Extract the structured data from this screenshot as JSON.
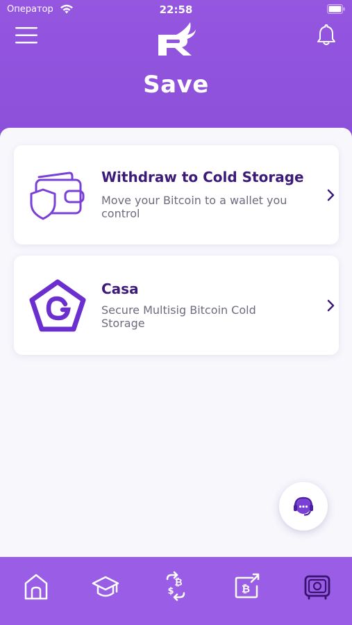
{
  "status_bar": {
    "carrier": "Оператор",
    "time": "22:58"
  },
  "header": {
    "title": "Save"
  },
  "cards": [
    {
      "title": "Withdraw to Cold Storage",
      "description": "Move your Bitcoin to a wallet you control",
      "icon": "wallet-shield-icon"
    },
    {
      "title": "Casa",
      "description": "Secure Multisig Bitcoin Cold Storage",
      "icon": "casa-logo-icon"
    }
  ],
  "tabbar": {
    "items": [
      {
        "icon": "home-icon"
      },
      {
        "icon": "graduation-cap-icon"
      },
      {
        "icon": "bitcoin-exchange-icon"
      },
      {
        "icon": "bitcoin-send-icon"
      },
      {
        "icon": "vault-icon",
        "active": true
      }
    ]
  },
  "colors": {
    "primary": "#8e52dc",
    "accent_dark": "#3c1a78",
    "tab_active": "#3a1270"
  }
}
